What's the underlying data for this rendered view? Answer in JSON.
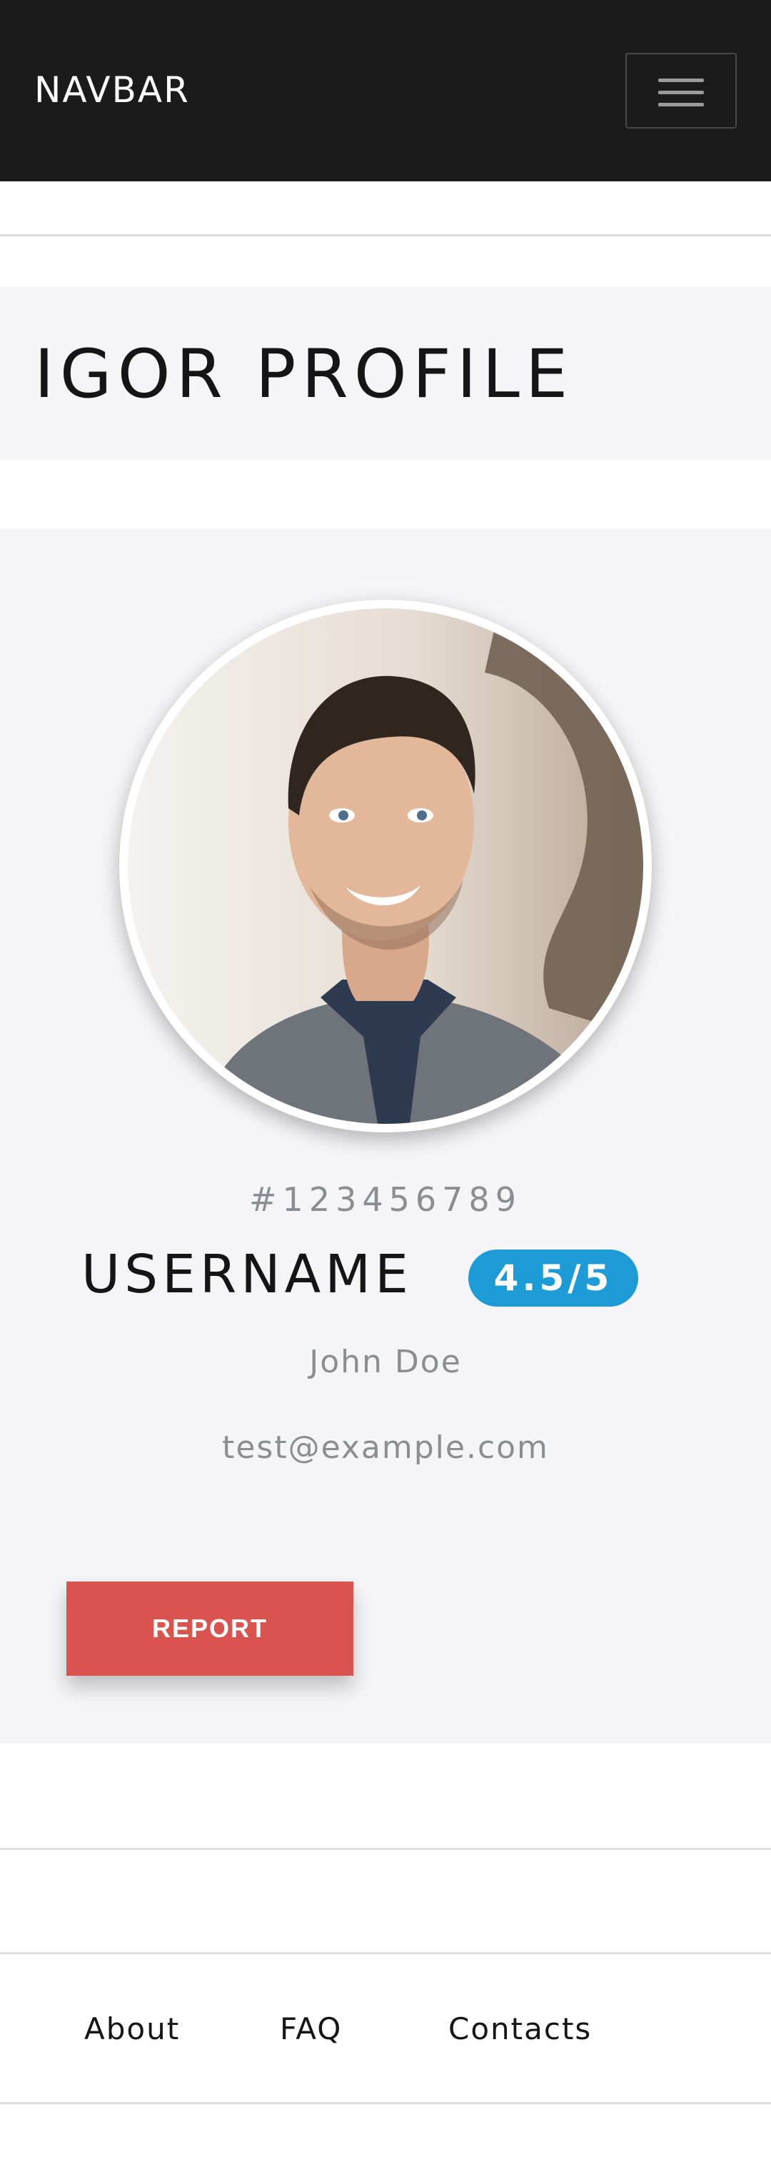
{
  "navbar": {
    "brand": "NAVBAR",
    "toggler_icon": "hamburger-menu-icon"
  },
  "page": {
    "title": "IGOR PROFILE"
  },
  "profile": {
    "avatar_icon": "profile-photo",
    "id": "#123456789",
    "username": "USERNAME",
    "rating": "4.5/5",
    "name": "John Doe",
    "email": "test@example.com",
    "report_label": "REPORT"
  },
  "footer": {
    "links": [
      "About",
      "FAQ",
      "Contacts"
    ]
  },
  "colors": {
    "navbar_bg": "#1b1b1b",
    "section_bg": "#f5f5f7",
    "badge": "#1d9bd7",
    "danger": "#d9534f",
    "muted_text": "#8a8d93"
  }
}
